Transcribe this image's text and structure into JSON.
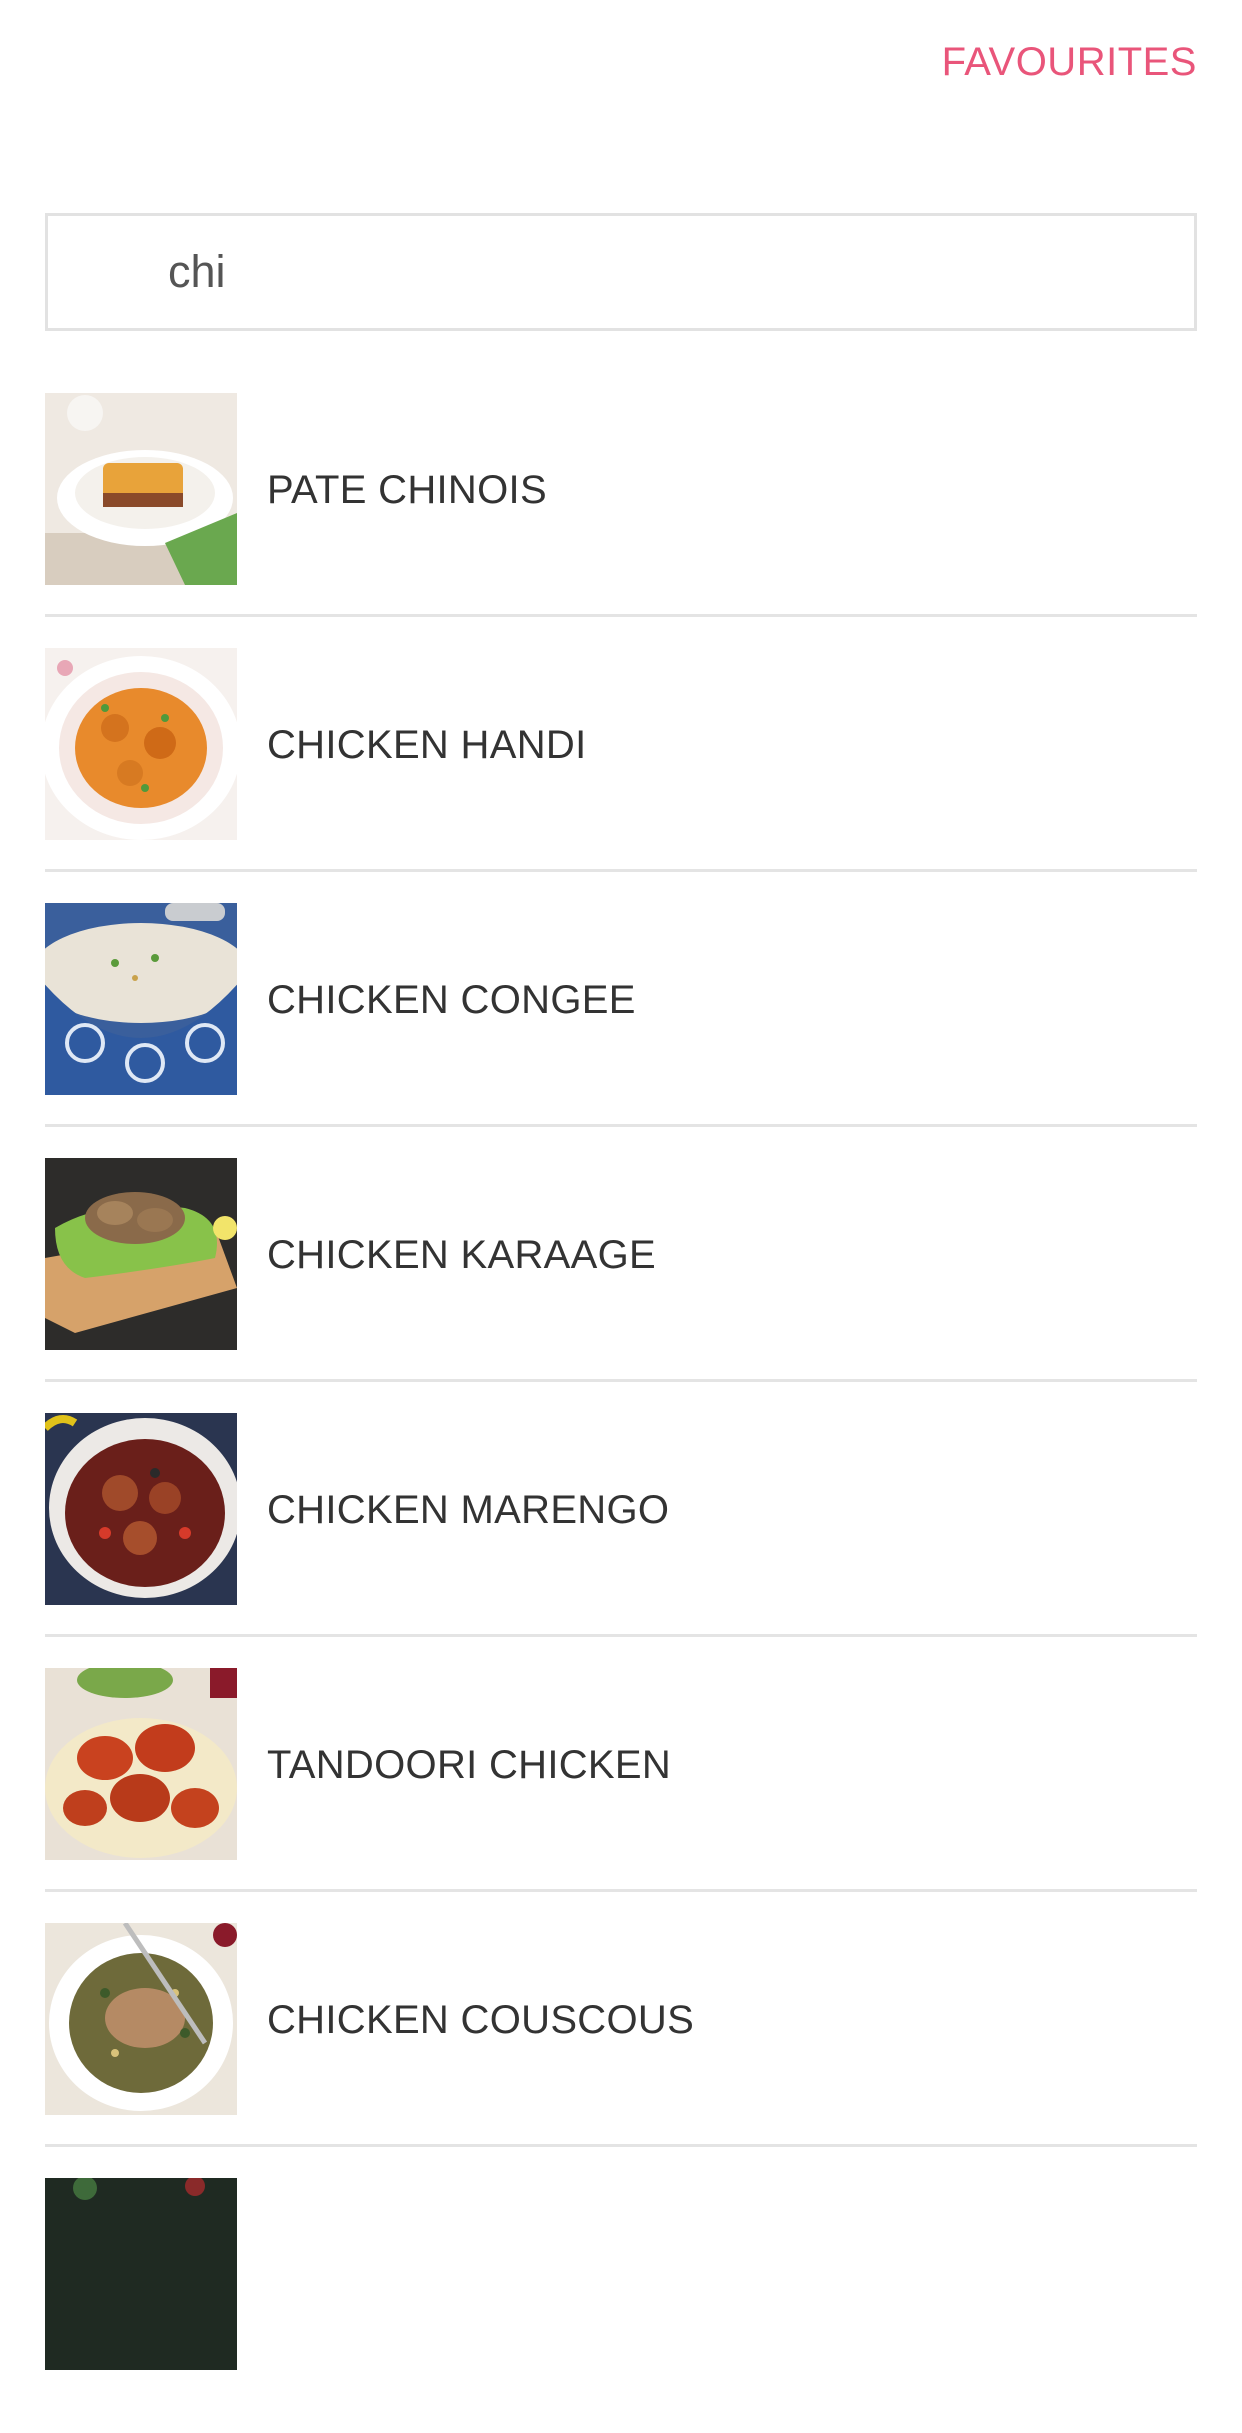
{
  "header": {
    "favourites_label": "FAVOURITES"
  },
  "search": {
    "value": "chi"
  },
  "results": [
    {
      "label": "PATE CHINOIS"
    },
    {
      "label": "CHICKEN HANDI"
    },
    {
      "label": "CHICKEN CONGEE"
    },
    {
      "label": "CHICKEN KARAAGE"
    },
    {
      "label": "CHICKEN MARENGO"
    },
    {
      "label": "TANDOORI CHICKEN"
    },
    {
      "label": "CHICKEN COUSCOUS"
    }
  ],
  "colors": {
    "accent": "#e9557a",
    "text": "#333333",
    "divider": "#e4e4e4",
    "search_border": "#e2e2e2"
  }
}
